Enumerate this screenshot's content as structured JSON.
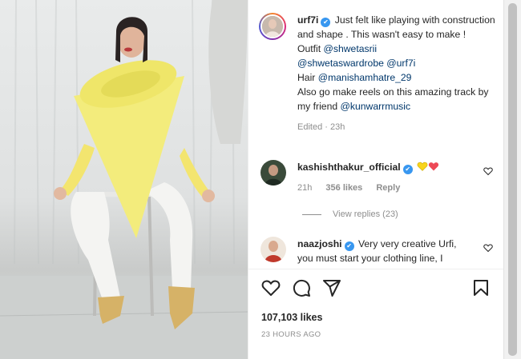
{
  "post": {
    "username": "urf7i",
    "caption_parts": [
      " Just felt like playing with construction and shape . This wasn't easy to make !",
      "Outfit ",
      "@shwetasrii",
      "@shwetaswardrobe",
      "@urf7i",
      "Hair ",
      "@manishamhatre_29",
      "Also go make reels on this amazing track by my friend ",
      "@kunwarrmusic"
    ],
    "edited_label": "Edited",
    "edited_time": "23h",
    "likes": "107,103 likes",
    "timestamp": "23 HOURS AGO"
  },
  "comments": [
    {
      "username": "kashishthakur_official",
      "text": "",
      "time": "21h",
      "likes": "356 likes",
      "reply": "Reply"
    },
    {
      "username": "naazjoshi",
      "text": "Very very creative Urfi, you must start your clothing line, I"
    }
  ],
  "view_replies": "View replies (23)",
  "icons": {
    "like": "heart-icon",
    "comment": "comment-icon",
    "share": "share-icon",
    "save": "bookmark-icon",
    "verified": "verified-badge-icon"
  },
  "colors": {
    "verified": "#3897f0",
    "link": "#00376b",
    "muted": "#8e8e8e",
    "heart_red": "#ed4956",
    "heart_yellow": "#f8d41c"
  }
}
